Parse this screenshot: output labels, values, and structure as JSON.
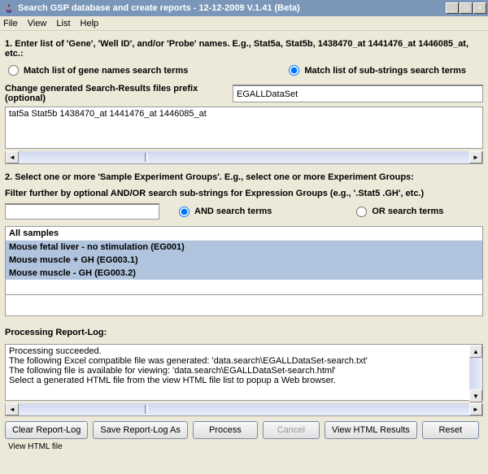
{
  "window": {
    "title": "Search GSP database and create reports - 12-12-2009 V.1.41 (Beta)"
  },
  "menu": {
    "file": "File",
    "view": "View",
    "list": "List",
    "help": "Help"
  },
  "section1": {
    "heading": "1. Enter list of 'Gene', 'Well ID', and/or 'Probe' names. E.g., Stat5a, Stat5b, 1438470_at 1441476_at 1446085_at, etc.:",
    "radio_gene": "Match list of gene names search terms",
    "radio_substr": "Match list of sub-strings search terms",
    "prefix_label": "Change generated Search-Results files prefix (optional)",
    "prefix_value": "EGALLDataSet",
    "term_input": "tat5a Stat5b 1438470_at 1441476_at 1446085_at"
  },
  "section2": {
    "heading": "2. Select one or more 'Sample Experiment Groups'. E.g., select one or more Experiment Groups:",
    "filter_label": "Filter further by optional AND/OR search sub-strings for Expression Groups (e.g., '.Stat5 .GH', etc.)",
    "filter_value": "",
    "radio_and": "AND search terms",
    "radio_or": "OR search terms",
    "list_header": "All samples",
    "items": [
      "Mouse fetal liver - no stimulation (EG001)",
      "Mouse muscle + GH (EG003.1)",
      "Mouse muscle - GH (EG003.2)"
    ]
  },
  "log": {
    "heading": "Processing Report-Log:",
    "text": "Processing succeeded.\nThe following Excel compatible file was generated: 'data.search\\EGALLDataSet-search.txt'\nThe following file is available for viewing: 'data.search\\EGALLDataSet-search.html'\nSelect a generated HTML file from the view HTML file list to popup a Web browser."
  },
  "buttons": {
    "clear": "Clear Report-Log",
    "save": "Save Report-Log As",
    "process": "Process",
    "cancel": "Cancel",
    "view": "View HTML Results",
    "reset": "Reset"
  },
  "status": "View HTML file"
}
